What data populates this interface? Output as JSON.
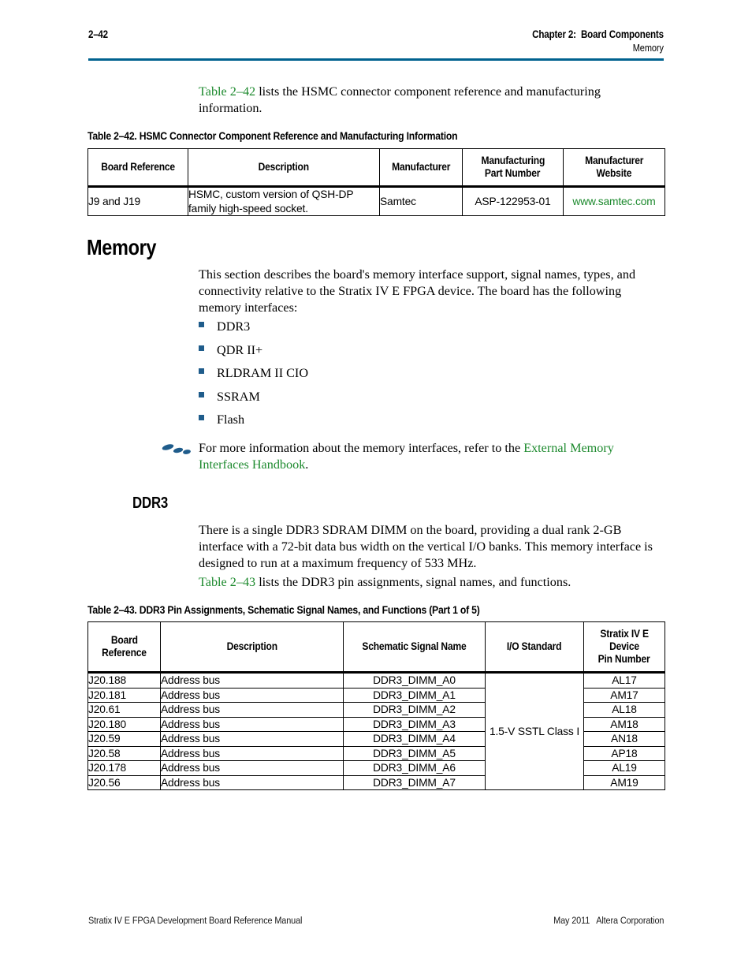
{
  "header": {
    "page_number": "2–42",
    "chapter": "Chapter 2:  Board Components",
    "section": "Memory",
    "rule_color": "#00628f"
  },
  "intro_paragraph": {
    "link_text": "Table 2–42",
    "rest": " lists the HSMC connector component reference and manufacturing information."
  },
  "table_2_42": {
    "caption": "Table 2–42.  HSMC Connector Component Reference and Manufacturing Information",
    "columns": [
      "Board Reference",
      "Description",
      "Manufacturer",
      [
        "Manufacturing",
        "Part Number"
      ],
      [
        "Manufacturer",
        "Website"
      ]
    ],
    "rows": [
      {
        "board_reference": "J9 and J19",
        "description": "HSMC, custom version of QSH-DP family high-speed socket.",
        "manufacturer": "Samtec",
        "part_number": "ASP-122953-01",
        "website": "www.samtec.com"
      }
    ]
  },
  "memory_section": {
    "heading": "Memory",
    "paragraph": "This section describes the board's memory interface support, signal names, types, and connectivity relative to the Stratix IV E FPGA device. The board has the following memory interfaces:",
    "bullets": [
      "DDR3",
      "QDR II+",
      "RLDRAM II CIO",
      "SSRAM",
      "Flash"
    ],
    "note": {
      "icon": "footprints-icon",
      "prefix": "For more information about the memory interfaces, refer to the ",
      "link": "External Memory Interfaces Handbook",
      "suffix": "."
    }
  },
  "ddr3_section": {
    "heading": "DDR3",
    "paragraph": "There is a single DDR3 SDRAM DIMM on the board, providing a dual rank 2-GB interface with a 72-bit data bus width on the vertical I/O banks. This memory interface is designed to run at a maximum frequency of 533 MHz.",
    "table_intro": {
      "link_text": "Table 2–43",
      "rest": " lists the DDR3 pin assignments, signal names, and functions."
    }
  },
  "table_2_43": {
    "caption": "Table 2–43.  DDR3 Pin Assignments, Schematic Signal Names, and Functions  (Part 1 of 5)",
    "columns": [
      [
        "Board",
        "Reference"
      ],
      [
        "Description"
      ],
      [
        "Schematic Signal Name"
      ],
      [
        "I/O Standard"
      ],
      [
        "Stratix IV E",
        "Device",
        "Pin Number"
      ]
    ],
    "io_standard": "1.5-V SSTL Class I",
    "rows": [
      {
        "board_reference": "J20.188",
        "description": "Address bus",
        "signal_name": "DDR3_DIMM_A0",
        "pin_number": "AL17"
      },
      {
        "board_reference": "J20.181",
        "description": "Address bus",
        "signal_name": "DDR3_DIMM_A1",
        "pin_number": "AM17"
      },
      {
        "board_reference": "J20.61",
        "description": "Address bus",
        "signal_name": "DDR3_DIMM_A2",
        "pin_number": "AL18"
      },
      {
        "board_reference": "J20.180",
        "description": "Address bus",
        "signal_name": "DDR3_DIMM_A3",
        "pin_number": "AM18"
      },
      {
        "board_reference": "J20.59",
        "description": "Address bus",
        "signal_name": "DDR3_DIMM_A4",
        "pin_number": "AN18"
      },
      {
        "board_reference": "J20.58",
        "description": "Address bus",
        "signal_name": "DDR3_DIMM_A5",
        "pin_number": "AP18"
      },
      {
        "board_reference": "J20.178",
        "description": "Address bus",
        "signal_name": "DDR3_DIMM_A6",
        "pin_number": "AL19"
      },
      {
        "board_reference": "J20.56",
        "description": "Address bus",
        "signal_name": "DDR3_DIMM_A7",
        "pin_number": "AM19"
      }
    ]
  },
  "footer": {
    "left": "Stratix IV E FPGA Development Board Reference Manual",
    "right": "May 2011   Altera Corporation"
  },
  "colors": {
    "link_green": "#1d8a2e",
    "rule_blue": "#00628f",
    "bullet_blue": "#1f5c8b"
  }
}
